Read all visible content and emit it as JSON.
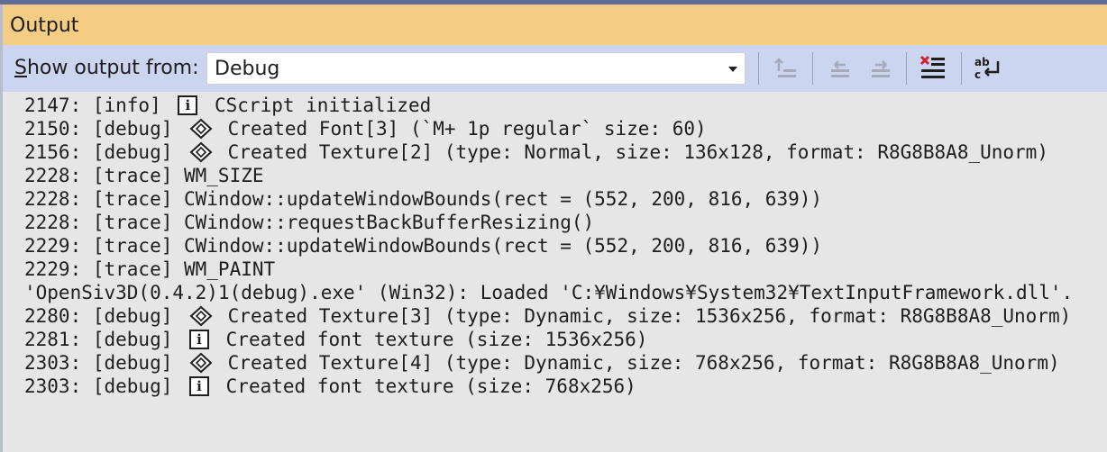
{
  "header": {
    "title": "Output"
  },
  "toolbar": {
    "show_output_from_label_u": "S",
    "show_output_from_label_rest": "how output from:",
    "source_selected": "Debug"
  },
  "log": [
    {
      "prefix": "2147: [info] ",
      "icon": "info-icon",
      "text": " CScript initialized"
    },
    {
      "prefix": "2150: [debug] ",
      "icon": "diamond-icon",
      "text": " Created Font[3] (`M+ 1p regular` size: 60)"
    },
    {
      "prefix": "2156: [debug] ",
      "icon": "diamond-icon",
      "text": " Created Texture[2] (type: Normal, size: 136x128, format: R8G8B8A8_Unorm)"
    },
    {
      "prefix": "2228: [trace] WM_SIZE",
      "icon": "",
      "text": ""
    },
    {
      "prefix": "2228: [trace] CWindow::updateWindowBounds(rect = (552, 200, 816, 639))",
      "icon": "",
      "text": ""
    },
    {
      "prefix": "2228: [trace] CWindow::requestBackBufferResizing()",
      "icon": "",
      "text": ""
    },
    {
      "prefix": "2229: [trace] CWindow::updateWindowBounds(rect = (552, 200, 816, 639))",
      "icon": "",
      "text": ""
    },
    {
      "prefix": "2229: [trace] WM_PAINT",
      "icon": "",
      "text": ""
    },
    {
      "prefix": "'OpenSiv3D(0.4.2)1(debug).exe' (Win32): Loaded 'C:¥Windows¥System32¥TextInputFramework.dll'.",
      "icon": "",
      "text": ""
    },
    {
      "prefix": "2280: [debug] ",
      "icon": "diamond-icon",
      "text": " Created Texture[3] (type: Dynamic, size: 1536x256, format: R8G8B8A8_Unorm)"
    },
    {
      "prefix": "2281: [debug] ",
      "icon": "info-icon",
      "text": " Created font texture (size: 1536x256)"
    },
    {
      "prefix": "2303: [debug] ",
      "icon": "diamond-icon",
      "text": " Created Texture[4] (type: Dynamic, size: 768x256, format: R8G8B8A8_Unorm)"
    },
    {
      "prefix": "2303: [debug] ",
      "icon": "info-icon",
      "text": " Created font texture (size: 768x256)"
    }
  ],
  "icons": {
    "info_glyph": "i"
  }
}
